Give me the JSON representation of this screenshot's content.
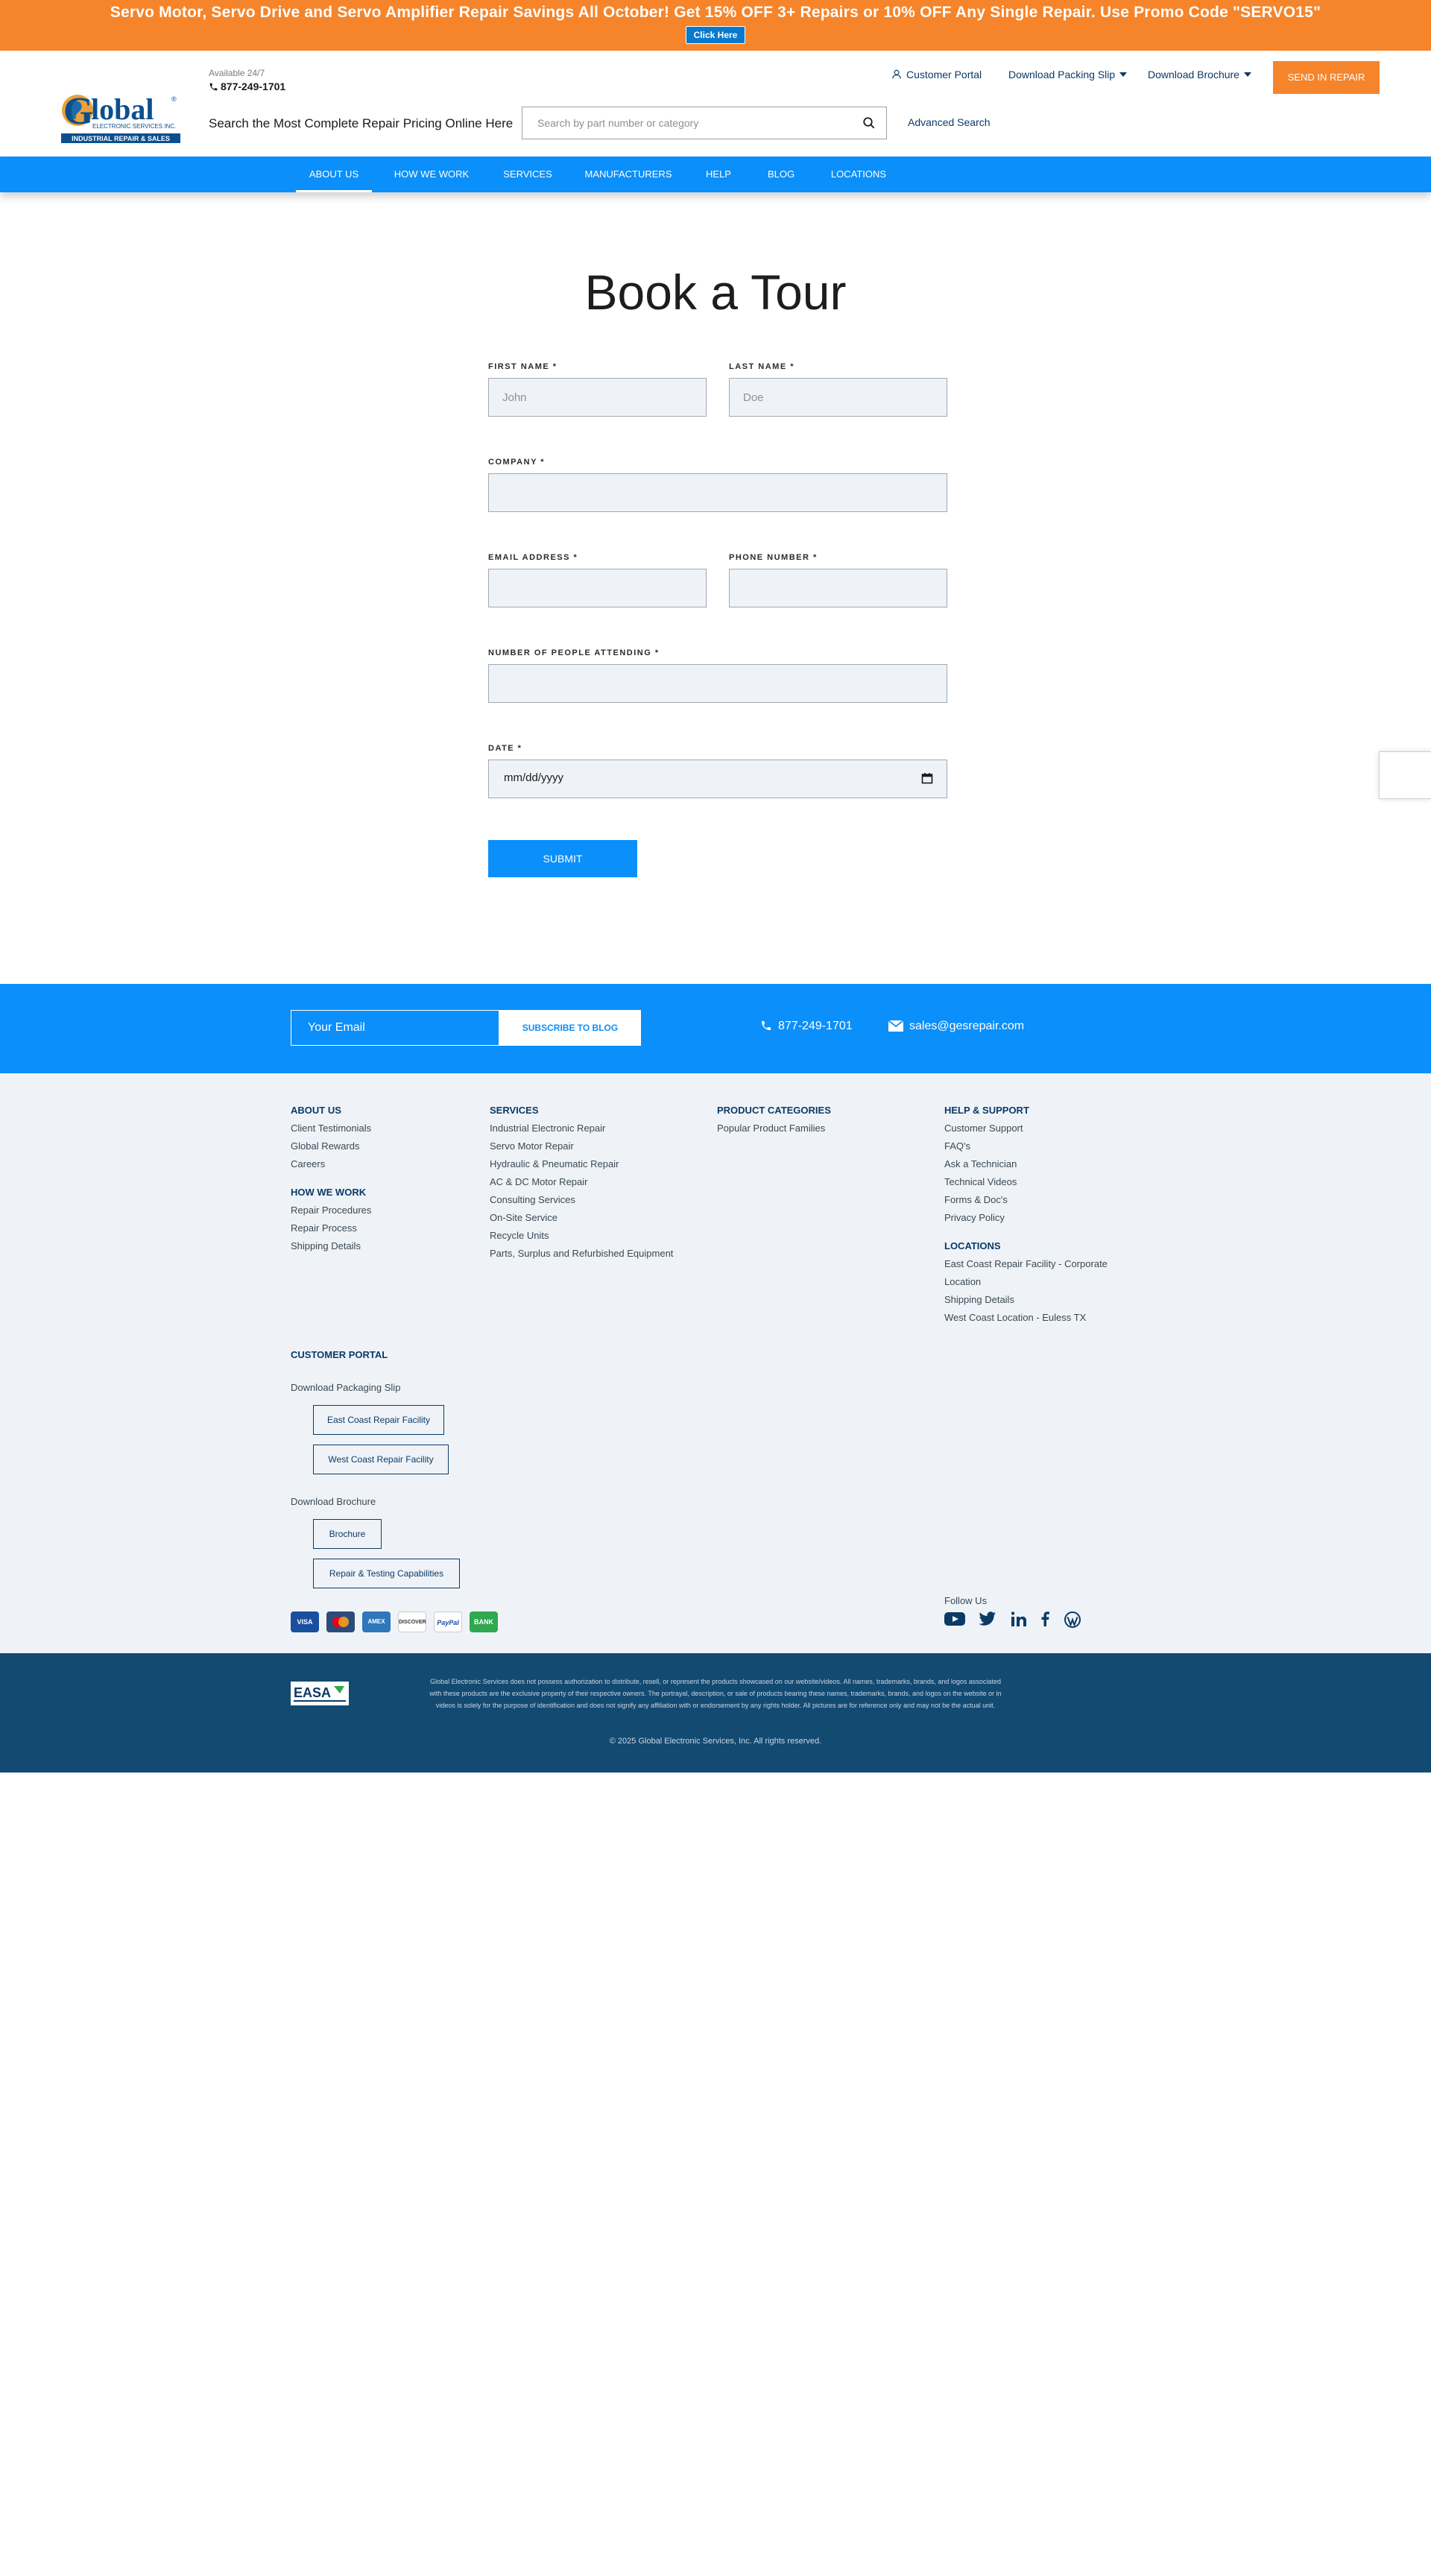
{
  "promo": {
    "text": "Servo Motor, Servo Drive and Servo Amplifier Repair Savings All October! Get 15% OFF 3+ Repairs or 10% OFF Any Single Repair. Use Promo Code \"SERVO15\"",
    "button": "Click Here"
  },
  "header": {
    "logo_name": "Global",
    "logo_sub": "ELECTRONIC SERVICES INC.",
    "logo_tag": "INDUSTRIAL REPAIR & SALES",
    "available": "Available 24/7",
    "phone": "877-249-1701",
    "tagline": "Search the Most Complete Repair Pricing Online Here",
    "search_placeholder": "Search by part number or category",
    "advanced_search": "Advanced Search",
    "customer_portal": "Customer Portal",
    "packing_slip": "Download Packing Slip",
    "brochure": "Download Brochure",
    "send_repair": "SEND IN REPAIR"
  },
  "nav": [
    "ABOUT US",
    "HOW WE WORK",
    "SERVICES",
    "MANUFACTURERS",
    "HELP",
    "BLOG",
    "LOCATIONS"
  ],
  "form": {
    "title": "Book a Tour",
    "first_name_label": "FIRST NAME *",
    "first_name_placeholder": "John",
    "last_name_label": "LAST NAME *",
    "last_name_placeholder": "Doe",
    "company_label": "COMPANY *",
    "email_label": "EMAIL ADDRESS *",
    "phone_label": "PHONE NUMBER *",
    "people_label": "NUMBER OF PEOPLE ATTENDING *",
    "date_label": "DATE *",
    "date_value": "mm/dd/yyyy",
    "submit": "SUBMIT"
  },
  "band": {
    "email_placeholder": "Your Email",
    "subscribe": "SUBSCRIBE TO BLOG",
    "phone": "877-249-1701",
    "email": "sales@gesrepair.com"
  },
  "footer": {
    "about_head": "ABOUT US",
    "about": [
      "Client Testimonials",
      "Global Rewards",
      "Careers"
    ],
    "how_head": "HOW WE WORK",
    "how": [
      "Repair Procedures",
      "Repair Process",
      "Shipping Details"
    ],
    "services_head": "SERVICES",
    "services": [
      "Industrial Electronic Repair",
      "Servo Motor Repair",
      "Hydraulic & Pneumatic Repair",
      "AC & DC Motor Repair",
      "Consulting Services",
      "On-Site Service",
      "Recycle Units",
      "Parts, Surplus and Refurbished Equipment"
    ],
    "products_head": "PRODUCT CATEGORIES",
    "products": [
      "Popular Product Families"
    ],
    "help_head": "HELP & SUPPORT",
    "help": [
      "Customer Support",
      "FAQ's",
      "Ask a Technician",
      "Technical Videos",
      "Forms & Doc's",
      "Privacy Policy"
    ],
    "locations_head": "LOCATIONS",
    "locations": [
      "East Coast Repair Facility - Corporate",
      "Location",
      "Shipping Details",
      "West Coast Location - Euless TX"
    ],
    "portal_head": "CUSTOMER PORTAL",
    "packaging_label": "Download Packaging Slip",
    "east_btn": "East Coast Repair Facility",
    "west_btn": "West Coast Repair Facility",
    "brochure_label": "Download Brochure",
    "brochure_btn": "Brochure",
    "repair_btn": "Repair & Testing Capabilities",
    "follow": "Follow Us",
    "payments": [
      "VISA",
      "MC",
      "AMEX",
      "DISCOVER",
      "PayPal",
      "BANK"
    ]
  },
  "bottom": {
    "easa": "EASA",
    "disclaimer": "Global Electronic Services does not possess authorization to distribute, resell, or represent the products showcased on our website/videos. All names, trademarks, brands, and logos associated with these products are the exclusive property of their respective owners. The portrayal, description, or sale of products bearing these names, trademarks, brands, and logos on the website or in videos is solely for the purpose of identification and does not signify any affiliation with or endorsement by any rights holder. All pictures are for reference only and may not be the actual unit.",
    "copyright": "© 2025 Global Electronic Services, Inc. All rights reserved."
  },
  "colors": {
    "promo_orange": "#f5842b",
    "nav_blue": "#0b8ffa",
    "dark_navy": "#134a72",
    "link_navy": "#0b3a66",
    "footer_bg": "#eff3f8"
  }
}
